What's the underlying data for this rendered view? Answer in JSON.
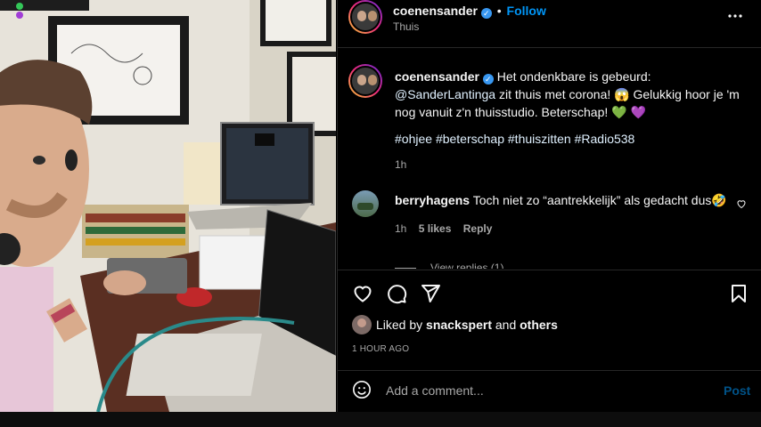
{
  "post": {
    "author": "coenensander",
    "follow_label": "Follow",
    "separator": "•",
    "location": "Thuis",
    "more_label": "•••"
  },
  "caption": {
    "author": "coenensander",
    "text_1": "Het ondenkbare is gebeurd:",
    "mention": "@SanderLantinga",
    "text_2": "zit thuis met corona! 😱 Gelukkig hoor je 'm nog vanuit z'n thuisstudio. Beterschap! 💚 💜",
    "hashtags": [
      "#ohjee",
      "#beterschap",
      "#thuiszitten",
      "#Radio538"
    ],
    "time": "1h"
  },
  "comments": [
    {
      "author": "berryhagens",
      "text": "Toch niet zo “aantrekkelijk” als gedacht dus🤣",
      "time": "1h",
      "likes": "5 likes",
      "reply_label": "Reply"
    }
  ],
  "view_replies": "View replies (1)",
  "likes": {
    "prefix": "Liked by",
    "user": "snackspert",
    "conj": "and",
    "others": "others"
  },
  "timestamp": "1 HOUR AGO",
  "comment_box": {
    "placeholder": "Add a comment...",
    "post_label": "Post"
  },
  "colors": {
    "accent": "#0095f6",
    "background": "#000000",
    "muted": "#a8a8a8",
    "link": "#e0f1ff"
  }
}
